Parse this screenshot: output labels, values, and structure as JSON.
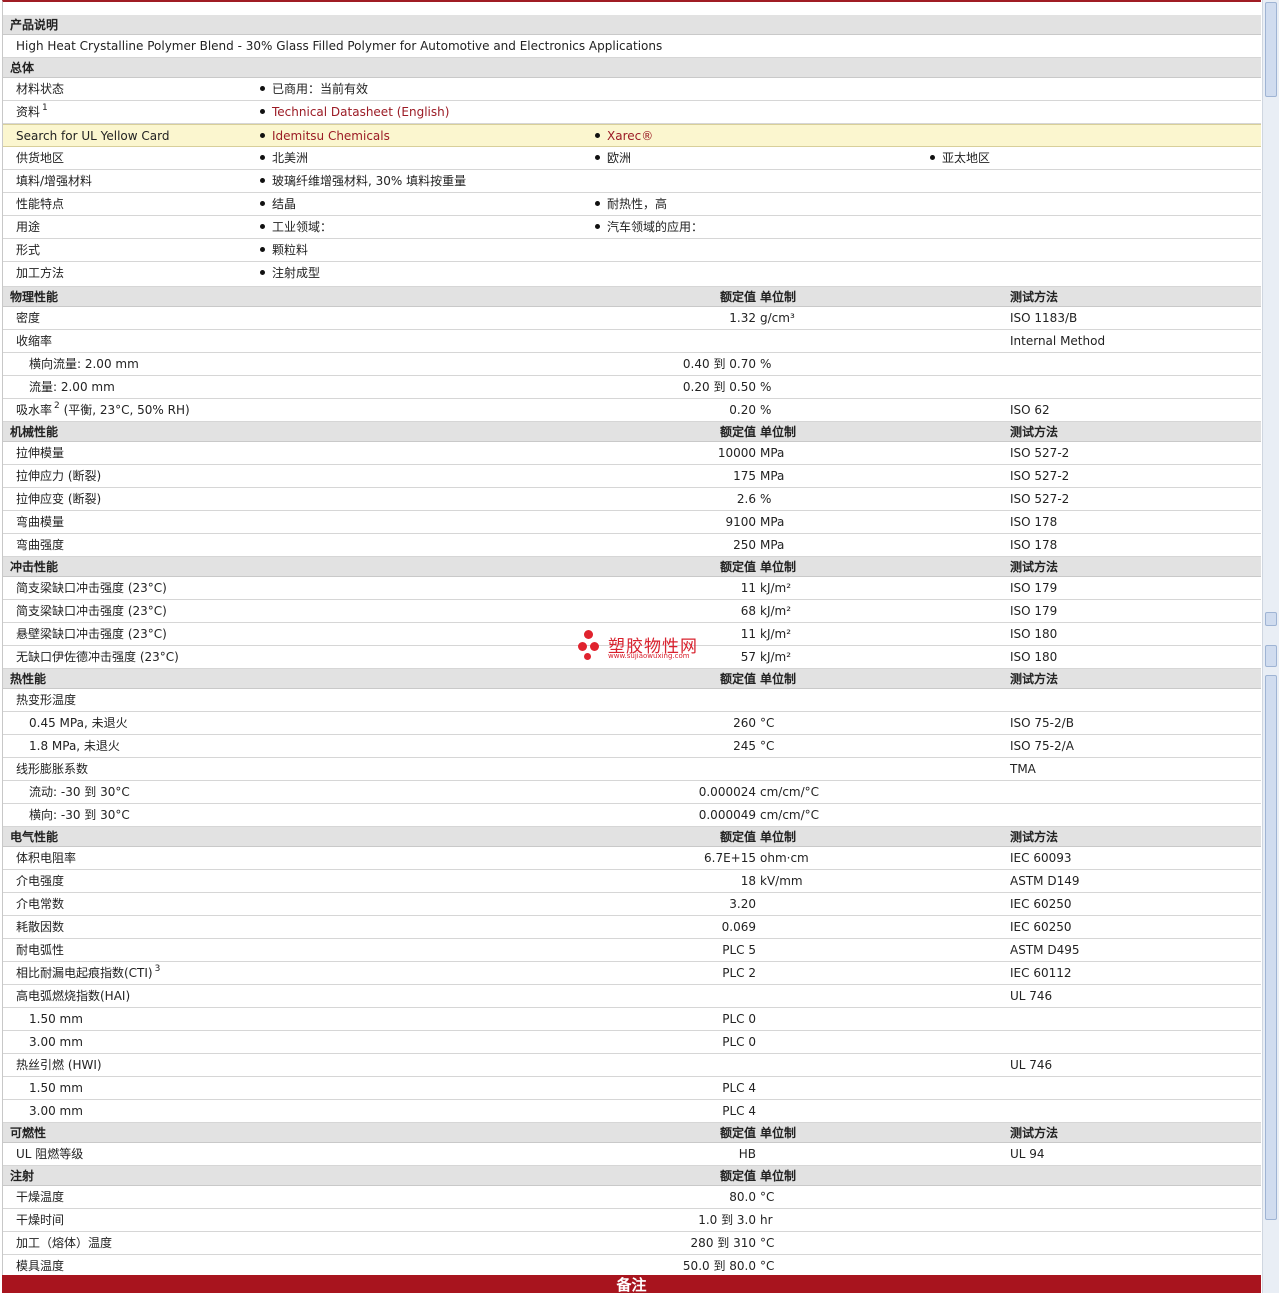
{
  "sections": {
    "description": {
      "title": "产品说明",
      "text": "High Heat Crystalline Polymer Blend - 30% Glass Filled Polymer for Automotive and Electronics Applications"
    },
    "general": {
      "title": "总体",
      "status_label": "材料状态",
      "status_value": "已商用：当前有效",
      "resources_label": "资料",
      "resources_sup": "1",
      "resources_link": "Technical Datasheet (English)",
      "ul_label": "Search for UL Yellow Card",
      "ul_link1": "Idemitsu Chemicals",
      "ul_link2": "Xarec®",
      "region_label": "供货地区",
      "region_values": [
        "北美洲",
        "欧洲",
        "亚太地区"
      ],
      "filler_label": "填料/增强材料",
      "filler_value": "玻璃纤维增强材料, 30% 填料按重量",
      "features_label": "性能特点",
      "features_values": [
        "结晶",
        "耐热性，高"
      ],
      "uses_label": "用途",
      "uses_values": [
        "工业领域：",
        "汽车领域的应用："
      ],
      "form_label": "形式",
      "form_value": "颗粒料",
      "process_label": "加工方法",
      "process_value": "注射成型"
    },
    "columns": {
      "nominal": "额定值",
      "unit": "单位制",
      "method": "测试方法"
    },
    "physical": {
      "title": "物理性能",
      "rows": [
        {
          "label": "密度",
          "value": "1.32",
          "unit": "g/cm³",
          "method": "ISO 1183/B"
        },
        {
          "label": "收缩率",
          "value": "",
          "unit": "",
          "method": "Internal Method"
        },
        {
          "label": "横向流量: 2.00 mm",
          "value": "0.40 到  0.70",
          "unit": "%",
          "method": ""
        },
        {
          "label": "流量: 2.00 mm",
          "value": "0.20 到  0.50",
          "unit": "%",
          "method": ""
        },
        {
          "label": "吸水率",
          "sup": "2",
          "label_tail": " (平衡, 23°C, 50% RH)",
          "value": "0.20",
          "unit": "%",
          "method": "ISO 62"
        }
      ]
    },
    "mechanical": {
      "title": "机械性能",
      "rows": [
        {
          "label": "拉伸模量",
          "value": "10000",
          "unit": "MPa",
          "method": "ISO 527-2"
        },
        {
          "label": "拉伸应力  (断裂)",
          "value": "175",
          "unit": "MPa",
          "method": "ISO 527-2"
        },
        {
          "label": "拉伸应变  (断裂)",
          "value": "2.6",
          "unit": "%",
          "method": "ISO 527-2"
        },
        {
          "label": "弯曲模量",
          "value": "9100",
          "unit": "MPa",
          "method": "ISO 178"
        },
        {
          "label": "弯曲强度",
          "value": "250",
          "unit": "MPa",
          "method": "ISO 178"
        }
      ]
    },
    "impact": {
      "title": "冲击性能",
      "rows": [
        {
          "label": "简支梁缺口冲击强度  (23°C)",
          "value": "11",
          "unit": "kJ/m²",
          "method": "ISO 179"
        },
        {
          "label": "简支梁缺口冲击强度  (23°C)",
          "value": "68",
          "unit": "kJ/m²",
          "method": "ISO 179"
        },
        {
          "label": "悬壁梁缺口冲击强度  (23°C)",
          "value": "11",
          "unit": "kJ/m²",
          "method": "ISO 180"
        },
        {
          "label": "无缺口伊佐德冲击强度  (23°C)",
          "value": "57",
          "unit": "kJ/m²",
          "method": "ISO 180"
        }
      ]
    },
    "thermal": {
      "title": "热性能",
      "rows": [
        {
          "label": "热变形温度",
          "value": "",
          "unit": "",
          "method": ""
        },
        {
          "label": "0.45 MPa, 未退火",
          "value": "260",
          "unit": "°C",
          "method": "ISO 75-2/B"
        },
        {
          "label": "1.8 MPa, 未退火",
          "value": "245",
          "unit": "°C",
          "method": "ISO 75-2/A"
        },
        {
          "label": "线形膨胀系数",
          "value": "",
          "unit": "",
          "method": "TMA"
        },
        {
          "label": "流动: -30 到  30°C",
          "value": "0.000024",
          "unit": "cm/cm/°C",
          "method": ""
        },
        {
          "label": "横向: -30 到  30°C",
          "value": "0.000049",
          "unit": "cm/cm/°C",
          "method": ""
        }
      ]
    },
    "electrical": {
      "title": "电气性能",
      "rows": [
        {
          "label": "体积电阻率",
          "value": "6.7E+15",
          "unit": "ohm·cm",
          "method": "IEC 60093"
        },
        {
          "label": "介电强度",
          "value": "18",
          "unit": "kV/mm",
          "method": "ASTM D149"
        },
        {
          "label": "介电常数",
          "value": "3.20",
          "unit": "",
          "method": "IEC 60250"
        },
        {
          "label": "耗散因数",
          "value": "0.069",
          "unit": "",
          "method": "IEC 60250"
        },
        {
          "label": "耐电弧性",
          "value": "PLC 5",
          "unit": "",
          "method": "ASTM D495"
        },
        {
          "label": "相比耐漏电起痕指数(CTI)",
          "sup": "3",
          "value": "PLC 2",
          "unit": "",
          "method": "IEC 60112"
        },
        {
          "label": "高电弧燃烧指数(HAI)",
          "value": "",
          "unit": "",
          "method": "UL 746"
        },
        {
          "label": "1.50 mm",
          "value": "PLC 0",
          "unit": "",
          "method": ""
        },
        {
          "label": "3.00 mm",
          "value": "PLC 0",
          "unit": "",
          "method": ""
        },
        {
          "label": "热丝引燃  (HWI)",
          "value": "",
          "unit": "",
          "method": "UL 746"
        },
        {
          "label": "1.50 mm",
          "value": "PLC 4",
          "unit": "",
          "method": ""
        },
        {
          "label": "3.00 mm",
          "value": "PLC 4",
          "unit": "",
          "method": ""
        }
      ]
    },
    "flammability": {
      "title": "可燃性",
      "rows": [
        {
          "label": "UL 阻燃等级",
          "value": "HB",
          "unit": "",
          "method": "UL 94"
        }
      ]
    },
    "injection": {
      "title": "注射",
      "rows": [
        {
          "label": "干燥温度",
          "value": "80.0",
          "unit": "°C",
          "method": ""
        },
        {
          "label": "干燥时间",
          "value": "1.0 到  3.0",
          "unit": "hr",
          "method": ""
        },
        {
          "label": "加工（熔体）温度",
          "value": "280 到  310",
          "unit": "°C",
          "method": ""
        },
        {
          "label": "模具温度",
          "value": "50.0 到  80.0",
          "unit": "°C",
          "method": ""
        }
      ]
    }
  },
  "footer": {
    "title": "备注"
  },
  "watermark": {
    "text": "塑胶物性网",
    "url": "www.sujiaowuxing.com"
  },
  "colors": {
    "accent": "#a8141e",
    "link": "#9b1b25",
    "section_bg": "#e2e2e2",
    "highlight_bg": "#fbf6cf"
  }
}
